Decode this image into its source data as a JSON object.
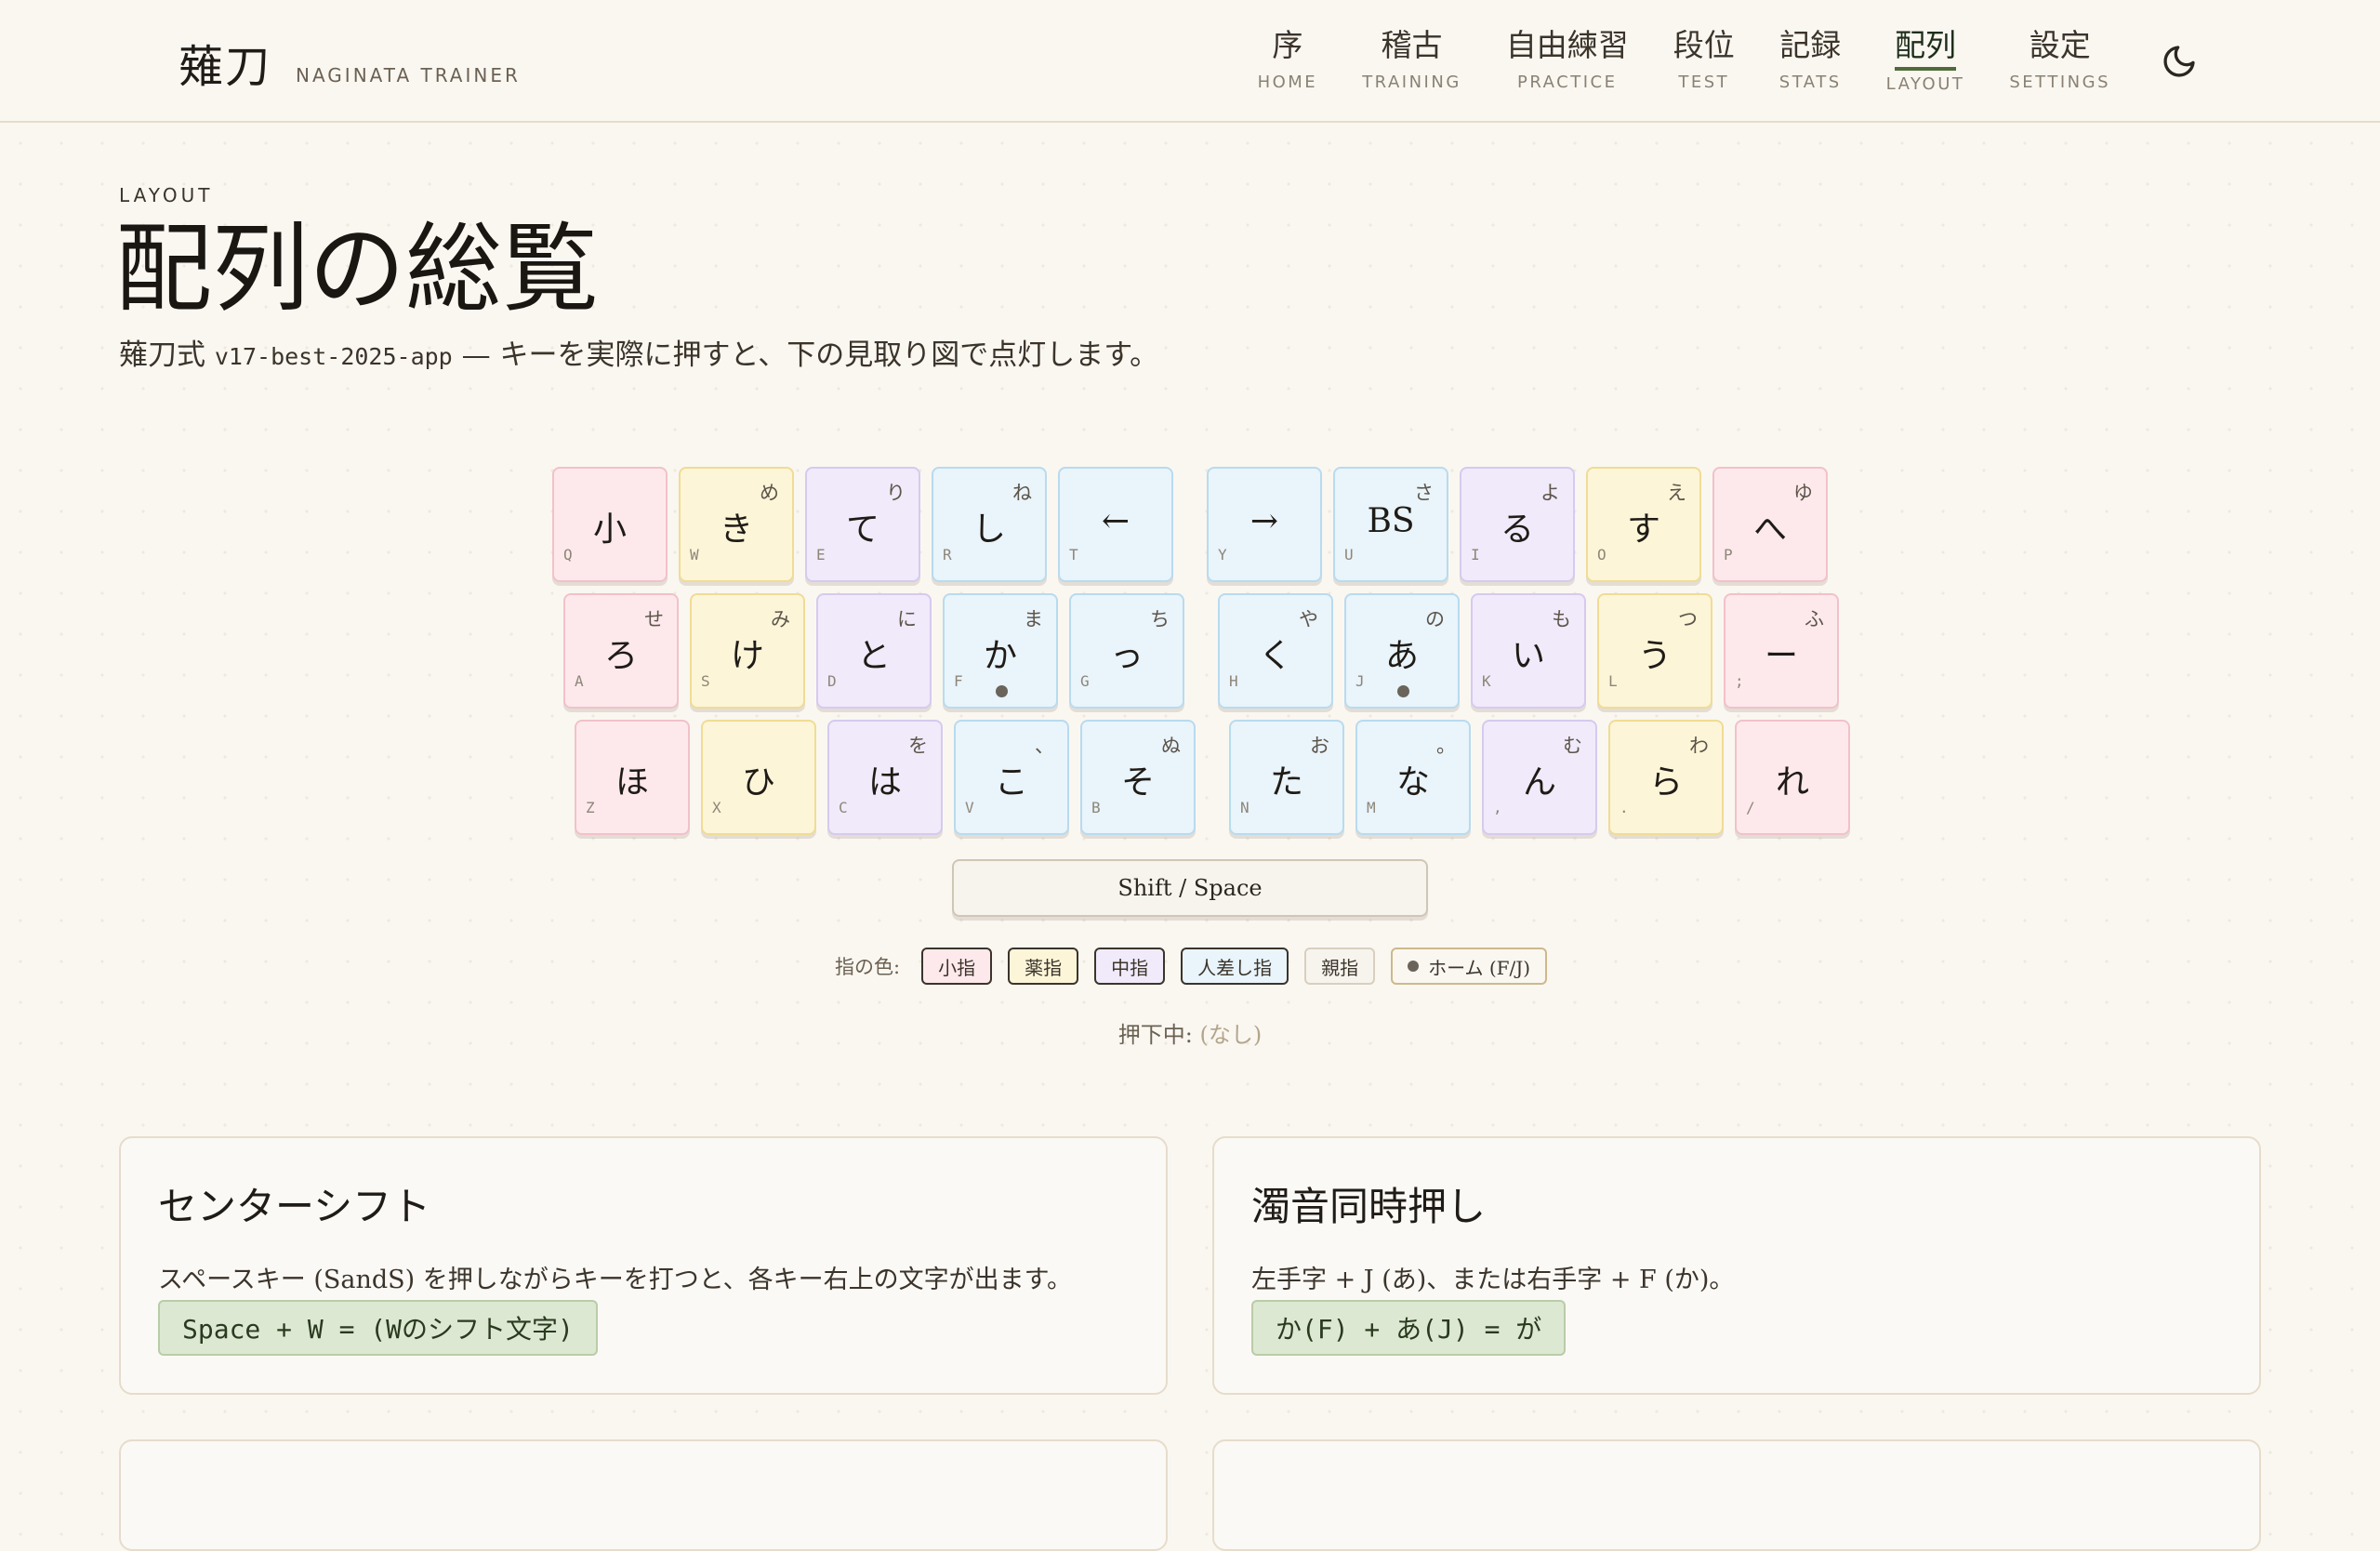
{
  "header": {
    "brand_jp": "薙刀",
    "brand_en": "NAGINATA TRAINER",
    "nav": [
      {
        "jp": "序",
        "en": "HOME"
      },
      {
        "jp": "稽古",
        "en": "TRAINING"
      },
      {
        "jp": "自由練習",
        "en": "PRACTICE"
      },
      {
        "jp": "段位",
        "en": "TEST"
      },
      {
        "jp": "記録",
        "en": "STATS"
      },
      {
        "jp": "配列",
        "en": "LAYOUT",
        "active": true
      },
      {
        "jp": "設定",
        "en": "SETTINGS"
      }
    ],
    "theme_icon": "moon-icon"
  },
  "page": {
    "eyebrow": "LAYOUT",
    "title": "配列の総覧",
    "subtitle_prefix": "薙刀式 ",
    "subtitle_version": "v17-best-2025-app",
    "subtitle_suffix": " — キーを実際に押すと、下の見取り図で点灯します。"
  },
  "keyboard": {
    "rows": [
      [
        {
          "main": "小",
          "shift": "",
          "qwerty": "Q",
          "finger": "pinky"
        },
        {
          "main": "き",
          "shift": "め",
          "qwerty": "W",
          "finger": "ring"
        },
        {
          "main": "て",
          "shift": "り",
          "qwerty": "E",
          "finger": "middle"
        },
        {
          "main": "し",
          "shift": "ね",
          "qwerty": "R",
          "finger": "index"
        },
        {
          "main": "←",
          "shift": "",
          "qwerty": "T",
          "finger": "index"
        },
        {
          "main": "→",
          "shift": "",
          "qwerty": "Y",
          "finger": "index"
        },
        {
          "main": "BS",
          "shift": "さ",
          "qwerty": "U",
          "finger": "index"
        },
        {
          "main": "る",
          "shift": "よ",
          "qwerty": "I",
          "finger": "middle"
        },
        {
          "main": "す",
          "shift": "え",
          "qwerty": "O",
          "finger": "ring"
        },
        {
          "main": "へ",
          "shift": "ゆ",
          "qwerty": "P",
          "finger": "pinky"
        }
      ],
      [
        {
          "main": "ろ",
          "shift": "せ",
          "qwerty": "A",
          "finger": "pinky"
        },
        {
          "main": "け",
          "shift": "み",
          "qwerty": "S",
          "finger": "ring"
        },
        {
          "main": "と",
          "shift": "に",
          "qwerty": "D",
          "finger": "middle"
        },
        {
          "main": "か",
          "shift": "ま",
          "qwerty": "F",
          "finger": "index",
          "home": true
        },
        {
          "main": "っ",
          "shift": "ち",
          "qwerty": "G",
          "finger": "index"
        },
        {
          "main": "く",
          "shift": "や",
          "qwerty": "H",
          "finger": "index"
        },
        {
          "main": "あ",
          "shift": "の",
          "qwerty": "J",
          "finger": "index",
          "home": true
        },
        {
          "main": "い",
          "shift": "も",
          "qwerty": "K",
          "finger": "middle"
        },
        {
          "main": "う",
          "shift": "つ",
          "qwerty": "L",
          "finger": "ring"
        },
        {
          "main": "ー",
          "shift": "ふ",
          "qwerty": ";",
          "finger": "pinky"
        }
      ],
      [
        {
          "main": "ほ",
          "shift": "",
          "qwerty": "Z",
          "finger": "pinky"
        },
        {
          "main": "ひ",
          "shift": "",
          "qwerty": "X",
          "finger": "ring"
        },
        {
          "main": "は",
          "shift": "を",
          "qwerty": "C",
          "finger": "middle"
        },
        {
          "main": "こ",
          "shift": "、",
          "qwerty": "V",
          "finger": "index"
        },
        {
          "main": "そ",
          "shift": "ぬ",
          "qwerty": "B",
          "finger": "index"
        },
        {
          "main": "た",
          "shift": "お",
          "qwerty": "N",
          "finger": "index"
        },
        {
          "main": "な",
          "shift": "。",
          "qwerty": "M",
          "finger": "index"
        },
        {
          "main": "ん",
          "shift": "む",
          "qwerty": ",",
          "finger": "middle"
        },
        {
          "main": "ら",
          "shift": "わ",
          "qwerty": ".",
          "finger": "ring"
        },
        {
          "main": "れ",
          "shift": "",
          "qwerty": "/",
          "finger": "pinky"
        }
      ]
    ],
    "space_label": "Shift / Space"
  },
  "legend": {
    "label": "指の色:",
    "pinky": "小指",
    "ring": "薬指",
    "middle": "中指",
    "index": "人差し指",
    "thumb": "親指",
    "home": "ホーム (F/J)"
  },
  "pressed": {
    "label": "押下中: ",
    "value": "(なし)"
  },
  "cards": [
    {
      "title": "センターシフト",
      "desc": "スペースキー (SandS) を押しながらキーを打つと、各キー右上の文字が出ます。",
      "code": "Space + W = (Wのシフト文字)"
    },
    {
      "title": "濁音同時押し",
      "desc": "左手字 + J (あ)、または右手字 + F (か)。",
      "code": "か(F) + あ(J) = が"
    }
  ],
  "colors": {
    "pinky": "#fde9ec",
    "ring": "#fdf5d8",
    "middle": "#f0eafa",
    "index": "#e9f4fb",
    "accent": "#4f6b3a",
    "code_bg": "#dde8d3"
  }
}
